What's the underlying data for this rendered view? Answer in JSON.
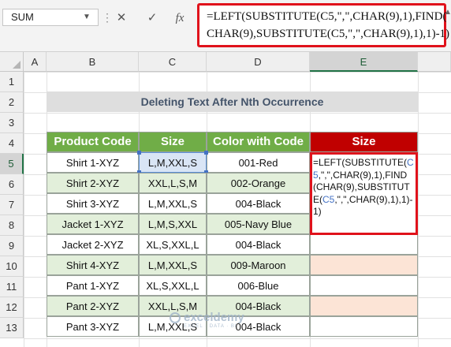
{
  "formula_bar": {
    "name_box": "SUM",
    "formula_line1": "=LEFT(SUBSTITUTE(C5,\",\",CHAR(9),1),FIND(",
    "formula_line2": "CHAR(9),SUBSTITUTE(C5,\",\",CHAR(9),1),1)-1)",
    "cancel_symbol": "✕",
    "enter_symbol": "✓",
    "fx_symbol": "fx"
  },
  "columns": [
    "A",
    "B",
    "C",
    "D",
    "E"
  ],
  "selected_column": "E",
  "rows": [
    "1",
    "2",
    "3",
    "4",
    "5",
    "6",
    "7",
    "8",
    "9",
    "10",
    "11",
    "12",
    "13"
  ],
  "selected_row": "5",
  "title": "Deleting Text After Nth Occurrence",
  "table": {
    "headers": [
      "Product Code",
      "Size",
      "Color with Code",
      "Size"
    ],
    "rows": [
      {
        "product": "Shirt 1-XYZ",
        "size": "L,M,XXL,S",
        "color": "001-Red"
      },
      {
        "product": "Shirt 2-XYZ",
        "size": "XXL,L,S,M",
        "color": "002-Orange"
      },
      {
        "product": "Shirt 3-XYZ",
        "size": "L,M,XXL,S",
        "color": "004-Black"
      },
      {
        "product": "Jacket 1-XYZ",
        "size": "L,M,S,XXL",
        "color": "005-Navy Blue"
      },
      {
        "product": "Jacket 2-XYZ",
        "size": "XL,S,XXL,L",
        "color": "004-Black"
      },
      {
        "product": "Shirt 4-XYZ",
        "size": "L,M,XXL,S",
        "color": "009-Maroon"
      },
      {
        "product": "Pant 1-XYZ",
        "size": "XL,S,XXL,L",
        "color": "006-Blue"
      },
      {
        "product": "Pant 2-XYZ",
        "size": "XXL,L,S,M",
        "color": "004-Black"
      },
      {
        "product": "Pant 3-XYZ",
        "size": "L,M,XXL,S",
        "color": "004-Black"
      }
    ]
  },
  "edit_cell": {
    "p1": "=LEFT(SUBSTITUTE(",
    "r1": "C5",
    "p2": ",\",\",CHAR(9),1),FIND(CHAR(9),SUBSTITUTE(",
    "r2": "C5",
    "p3": ",\",\",CHAR(9),1),1)-1)"
  },
  "watermark": {
    "brand": "exceldemy",
    "tagline": "EXCEL · DATA · BI"
  },
  "colors": {
    "header_green": "#70ad47",
    "header_red": "#c00000",
    "band_green": "#e2efda",
    "band_peach": "#fce4d6",
    "highlight_red": "#e0121b",
    "reference_blue": "#4472c4"
  }
}
